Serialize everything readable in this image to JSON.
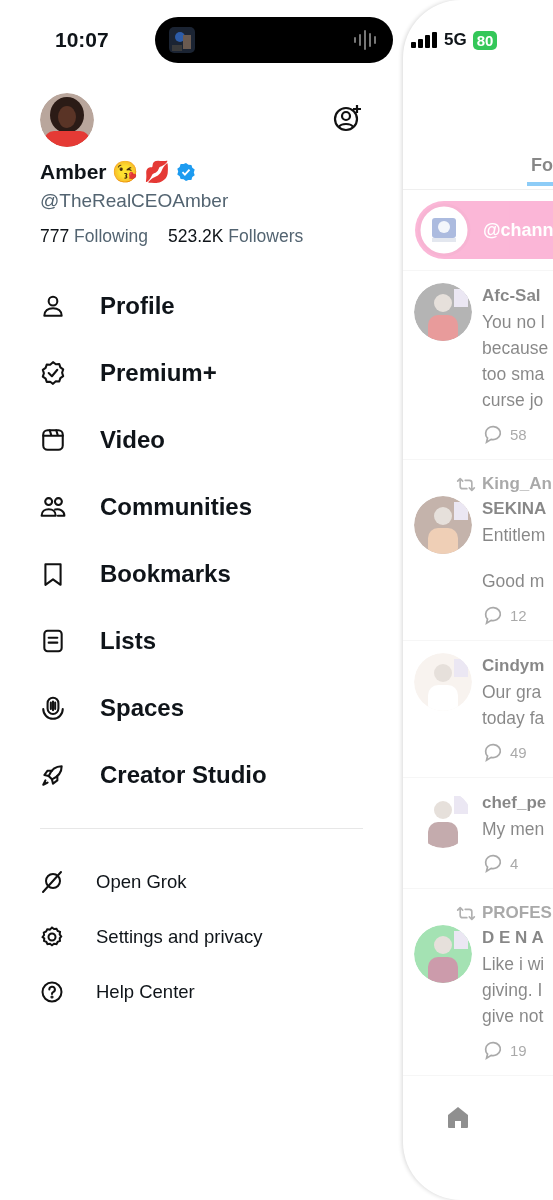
{
  "status_bar": {
    "time": "10:07",
    "network": "5G",
    "battery": "80"
  },
  "profile": {
    "name": "Amber 😘 💋",
    "verified": true,
    "handle": "@TheRealCEOAmber",
    "following_count": "777",
    "following_label": "Following",
    "followers_count": "523.2K",
    "followers_label": "Followers"
  },
  "menu": [
    {
      "label": "Profile"
    },
    {
      "label": "Premium+"
    },
    {
      "label": "Video"
    },
    {
      "label": "Communities"
    },
    {
      "label": "Bookmarks"
    },
    {
      "label": "Lists"
    },
    {
      "label": "Spaces"
    },
    {
      "label": "Creator Studio"
    }
  ],
  "secondary_menu": [
    {
      "label": "Open Grok"
    },
    {
      "label": "Settings and privacy"
    },
    {
      "label": "Help Center"
    }
  ],
  "feed": {
    "tab": "Fo",
    "channel_pill": "@chann",
    "posts": [
      {
        "name": "Afc-Sal",
        "paragraphs": [
          [
            "You no l",
            "because",
            "too sma",
            "curse jo"
          ]
        ],
        "replies": "58"
      },
      {
        "repost_by": "King_An",
        "name": "SEKINA",
        "paragraphs": [
          [
            "Entitlem"
          ],
          [
            "Good m"
          ]
        ],
        "replies": "12"
      },
      {
        "name": "Cindym",
        "paragraphs": [
          [
            "Our gra",
            "today fa"
          ]
        ],
        "replies": "49"
      },
      {
        "name": "chef_pe",
        "paragraphs": [
          [
            "My men"
          ]
        ],
        "replies": "4"
      },
      {
        "repost_by": "PROFES",
        "name": "D E N A",
        "paragraphs": [
          [
            "Like i wi",
            "giving. I",
            "give not"
          ]
        ],
        "replies": "19"
      }
    ]
  }
}
